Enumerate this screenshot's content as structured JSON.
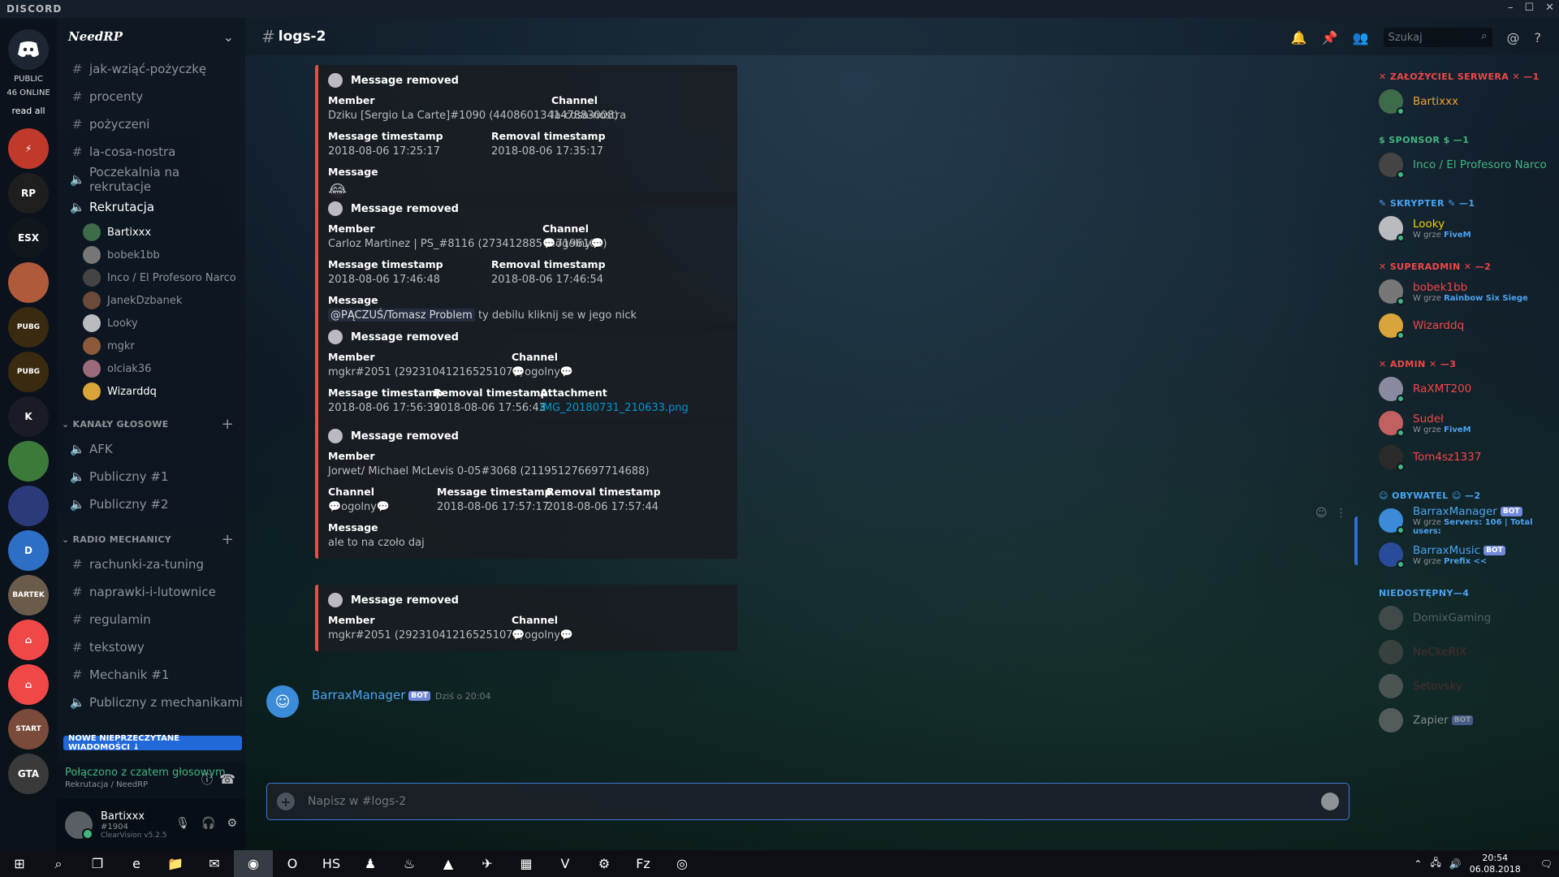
{
  "app": {
    "brand": "DISCORD",
    "window_controls": [
      "–",
      "☐",
      "✕"
    ]
  },
  "rail": {
    "public_label": "PUBLIC",
    "online_label": "46 ONLINE",
    "read_all": "read all",
    "servers": [
      {
        "name": "pikachu-server",
        "bg": "#c0392b",
        "text": "⚡"
      },
      {
        "name": "time-rp-server",
        "bg": "#1e1e1e",
        "text": "RP"
      },
      {
        "name": "esx-server",
        "bg": "#11161d",
        "text": "ESX"
      },
      {
        "name": "anime-server",
        "bg": "#b05a3c",
        "text": ""
      },
      {
        "name": "battlegrounds-server-1",
        "bg": "#3a2a10",
        "text": "PUBG"
      },
      {
        "name": "battlegrounds-server-2",
        "bg": "#3a2a10",
        "text": "PUBG"
      },
      {
        "name": "k-server",
        "bg": "#1b1b25",
        "text": "K"
      },
      {
        "name": "pepe-server",
        "bg": "#3c7a3a",
        "text": ""
      },
      {
        "name": "tower-server",
        "bg": "#2b3a7a",
        "text": ""
      },
      {
        "name": "d-server",
        "bg": "#2c6fc4",
        "text": "D"
      },
      {
        "name": "bartek-server",
        "bg": "#6b5b4a",
        "text": "BARTEK"
      },
      {
        "name": "discord-red-server-1",
        "bg": "#f04747",
        "text": "⌂"
      },
      {
        "name": "discord-red-server-2",
        "bg": "#f04747",
        "text": "⌂"
      },
      {
        "name": "start-server",
        "bg": "#7a4a3a",
        "text": "START"
      },
      {
        "name": "gta-server",
        "bg": "#3a3a3a",
        "text": "GTA"
      }
    ]
  },
  "sidebar": {
    "guild_name": "NeedRP",
    "channels_top": [
      {
        "icon": "#",
        "name": "jak-wziąć-pożyczkę"
      },
      {
        "icon": "#",
        "name": "procenty"
      },
      {
        "icon": "#",
        "name": "pożyczeni"
      },
      {
        "icon": "#",
        "name": "la-cosa-nostra"
      },
      {
        "icon": "🔈",
        "name": "Poczekalnia na rekrutacje"
      }
    ],
    "voice_channel": "Rekrutacja",
    "voice_users": [
      {
        "name": "Bartixxx",
        "bold": true,
        "color": "#3e6b4a"
      },
      {
        "name": "bobek1bb",
        "bold": false,
        "color": "#777"
      },
      {
        "name": "Inco / El Profesoro Narco",
        "bold": false,
        "color": "#444"
      },
      {
        "name": "JanekDzbanek",
        "bold": false,
        "color": "#6b4a3a"
      },
      {
        "name": "Looky",
        "bold": false,
        "color": "#b9bbbe"
      },
      {
        "name": "mgkr",
        "bold": false,
        "color": "#8a5a3a"
      },
      {
        "name": "olciak36",
        "bold": false,
        "color": "#9a6a7a"
      },
      {
        "name": "Wizarddq",
        "bold": true,
        "color": "#d9a43a"
      }
    ],
    "cat_voice": "KANAŁY GŁOSOWE",
    "voice_channels": [
      "AFK",
      "Publiczny #1",
      "Publiczny #2"
    ],
    "cat_radio": "RADIO MECHANICY",
    "radio_channels": [
      {
        "icon": "#",
        "name": "rachunki-za-tuning"
      },
      {
        "icon": "#",
        "name": "naprawki-i-lutownice"
      },
      {
        "icon": "#",
        "name": "regulamin"
      },
      {
        "icon": "#",
        "name": "tekstowy"
      },
      {
        "icon": "#",
        "name": "Mechanik #1"
      },
      {
        "icon": "🔈",
        "name": "Publiczny z mechanikami"
      }
    ],
    "new_messages": "NOWE NIEPRZECZYTANE WIADOMOŚCI ↓",
    "voice_connected": "Połączono z czatem głosowym",
    "voice_location": "Rekrutacja / NeedRP",
    "user": {
      "name": "Bartixxx",
      "tag": "#1904",
      "version": "ClearVision v5.2.5"
    }
  },
  "header": {
    "channel": "logs-2",
    "search_placeholder": "Szukaj"
  },
  "embeds": [
    {
      "title": "Message removed",
      "rows": [
        [
          {
            "n": "Member",
            "v": "Dziku [Sergio La Carte]#1090 (440860134147883008)"
          },
          {
            "n": "Channel",
            "v": "la-cosa-nostra"
          }
        ],
        [
          {
            "n": "Message timestamp",
            "v": "2018-08-06 17:25:17"
          },
          {
            "n": "Removal timestamp",
            "v": "2018-08-06 17:35:17"
          }
        ],
        [
          {
            "n": "Message",
            "v": "😂"
          }
        ]
      ]
    },
    {
      "title": "Message removed",
      "rows": [
        [
          {
            "n": "Member",
            "v": "Carloz Martinez | PS_#8116 (273412885647196161)"
          },
          {
            "n": "Channel",
            "v": "💬ogolny💬"
          }
        ],
        [
          {
            "n": "Message timestamp",
            "v": "2018-08-06 17:46:48"
          },
          {
            "n": "Removal timestamp",
            "v": "2018-08-06 17:46:54"
          }
        ],
        [
          {
            "n": "Message",
            "mention": "@PĄCZUŚ/Tomasz Problem",
            "v": " ty debilu kliknij se w jego nick"
          }
        ]
      ]
    },
    {
      "title": "Message removed",
      "rows": [
        [
          {
            "n": "Member",
            "v": "mgkr#2051 (292310412165251072)"
          },
          {
            "n": "Channel",
            "v": "💬ogolny💬"
          }
        ],
        [
          {
            "n": "Message timestamp",
            "v": "2018-08-06 17:56:39"
          },
          {
            "n": "Removal timestamp",
            "v": "2018-08-06 17:56:43"
          },
          {
            "n": "Attachment",
            "v": "IMG_20180731_210633.png",
            "link": true
          }
        ]
      ]
    },
    {
      "title": "Message removed",
      "rows": [
        [
          {
            "n": "Member",
            "v": "Jorwet/ Michael McLevis 0-05#3068 (211951276697714688)"
          }
        ],
        [
          {
            "n": "Channel",
            "v": "💬ogolny💬"
          },
          {
            "n": "Message timestamp",
            "v": "2018-08-06 17:57:17"
          },
          {
            "n": "Removal timestamp",
            "v": "2018-08-06 17:57:44"
          }
        ],
        [
          {
            "n": "Message",
            "v": "ale to na czoło daj"
          }
        ]
      ]
    },
    {
      "title": "Message removed",
      "rows": [
        [
          {
            "n": "Member",
            "v": "mgkr#2051 (292310412165251072)"
          },
          {
            "n": "Channel",
            "v": "💬ogolny💬"
          }
        ]
      ]
    }
  ],
  "bot_message": {
    "author": "BarraxManager",
    "bot_tag": "BOT",
    "timestamp": "Dziś o 20:04"
  },
  "composer": {
    "placeholder": "Napisz w #logs-2"
  },
  "members": [
    {
      "cat": "✕ ZAŁOŻYCIEL SERWERA ✕ —1",
      "cat_color": "#f04747",
      "items": [
        {
          "name": "Bartixxx",
          "color": "#f0a030",
          "av": "#3e6b4a",
          "game": ""
        }
      ]
    },
    {
      "cat": "$ SPONSOR $ —1",
      "cat_color": "#43b581",
      "items": [
        {
          "name": "Inco / El Profesoro Narco",
          "color": "#43b581",
          "av": "#444",
          "game": ""
        }
      ]
    },
    {
      "cat": "✎ SKRYPTER ✎ —1",
      "cat_color": "#4aa3f0",
      "items": [
        {
          "name": "Looky",
          "color": "#f0d000",
          "av": "#b9bbbe",
          "game": "W grze ",
          "game_b": "FiveM"
        }
      ]
    },
    {
      "cat": "✕ SUPERADMIN ✕ —2",
      "cat_color": "#f04747",
      "items": [
        {
          "name": "bobek1bb",
          "color": "#f04747",
          "av": "#777",
          "game": "W grze ",
          "game_b": "Rainbow Six Siege"
        },
        {
          "name": "Wizarddq",
          "color": "#f04747",
          "av": "#d9a43a",
          "game": ""
        }
      ]
    },
    {
      "cat": "✕ ADMIN ✕ —3",
      "cat_color": "#f04747",
      "items": [
        {
          "name": "RaXMT200",
          "color": "#f04747",
          "av": "#8a8aa0",
          "game": ""
        },
        {
          "name": "Sudeł",
          "color": "#f04747",
          "av": "#c06060",
          "game": "W grze ",
          "game_b": "FiveM"
        },
        {
          "name": "Tom4sz1337",
          "color": "#f04747",
          "av": "#2a2a2a",
          "game": ""
        }
      ]
    },
    {
      "cat": "☺ OBYWATEL ☺ —2",
      "cat_color": "#4aa3f0",
      "items": [
        {
          "name": "BarraxManager",
          "color": "#4aa3f0",
          "av": "#3b8bd8",
          "bot": "BOT",
          "game": "W grze ",
          "game_b": "Servers: 106 | Total users:"
        },
        {
          "name": "BarraxMusic",
          "color": "#4aa3f0",
          "av": "#2a4a9a",
          "bot": "BOT",
          "game": "W grze ",
          "game_b": "Prefix <<"
        }
      ]
    },
    {
      "cat": "NIEDOSTĘPNY—4",
      "cat_color": "#4aa3f0",
      "offline": true,
      "items": [
        {
          "name": "DomixGaming",
          "color": "#8e9297",
          "av": "#666",
          "game": ""
        },
        {
          "name": "NeCkeRIX",
          "color": "#7a3030",
          "av": "#555",
          "game": ""
        },
        {
          "name": "Setovsky",
          "color": "#7a3030",
          "av": "#777",
          "game": ""
        },
        {
          "name": "Zapier",
          "color": "#dcddde",
          "av": "#888",
          "bot": "BOT",
          "game": ""
        }
      ]
    }
  ],
  "taskbar": {
    "icons": [
      "⊞",
      "⌕",
      "❐",
      "e",
      "📁",
      "✉",
      "◉",
      "O",
      "HS",
      "♟",
      "♨",
      "▲",
      "✈",
      "▦",
      "V",
      "⚙",
      "Fz",
      "◎"
    ],
    "time": "20:54",
    "date": "06.08.2018"
  }
}
